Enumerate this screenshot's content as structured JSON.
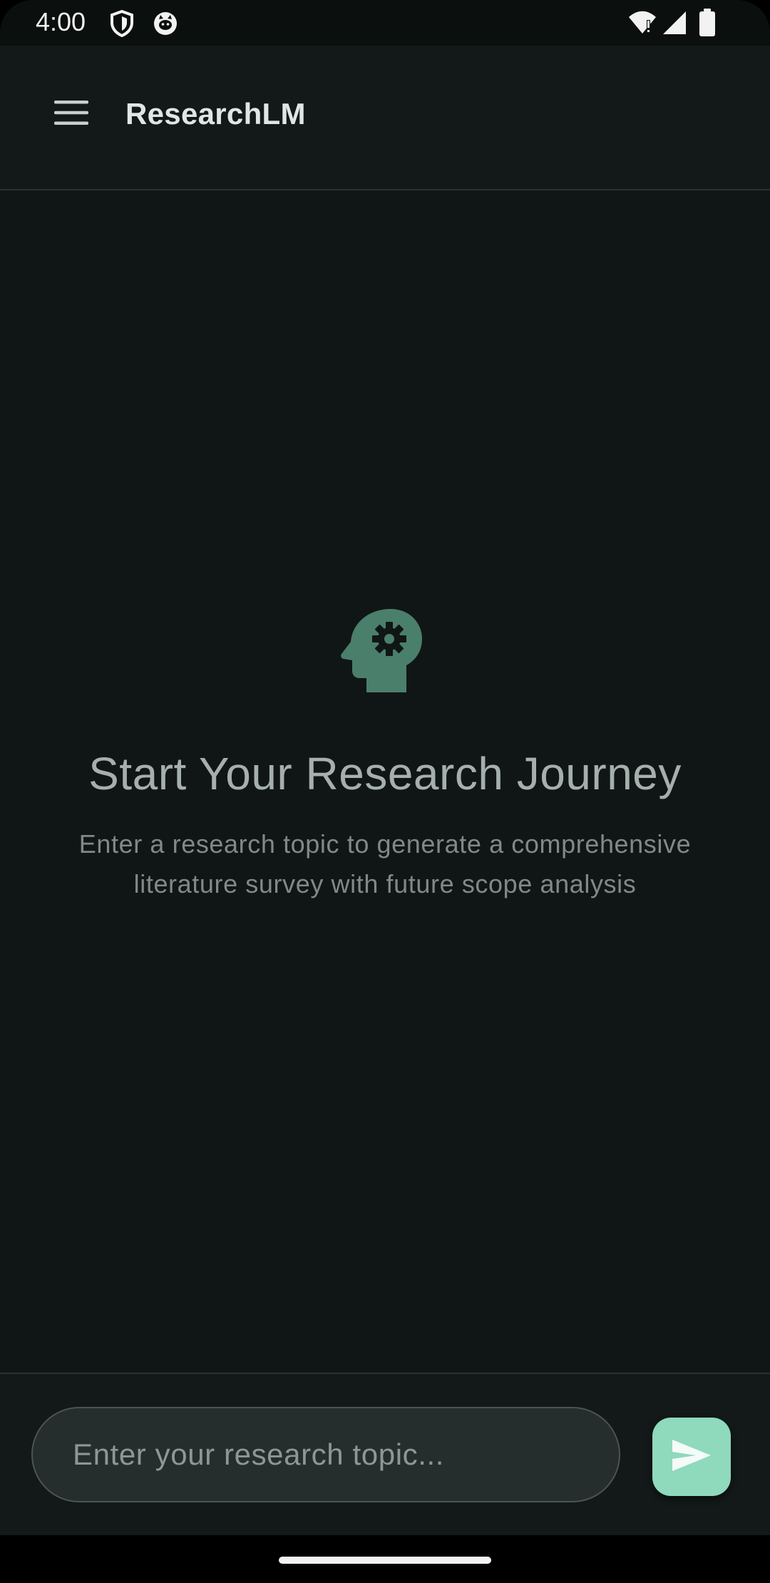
{
  "status_bar": {
    "time": "4:00",
    "icons_left": [
      "shield-icon",
      "cat-icon"
    ],
    "icons_right": [
      "wifi-icon",
      "signal-icon",
      "battery-icon"
    ]
  },
  "app_bar": {
    "menu_icon": "hamburger-menu-icon",
    "title": "ResearchLM"
  },
  "empty_state": {
    "icon": "psychology-head-gear-icon",
    "icon_color": "#4a7f6b",
    "title": "Start Your Research Journey",
    "subtitle": "Enter a research topic to generate a comprehensive literature survey with future scope analysis"
  },
  "input_bar": {
    "placeholder": "Enter your research topic...",
    "value": "",
    "send_icon": "send-icon",
    "send_color": "#8fd9bd"
  },
  "colors": {
    "background": "#101615",
    "app_bar": "#121918",
    "accent": "#8fd9bd"
  }
}
